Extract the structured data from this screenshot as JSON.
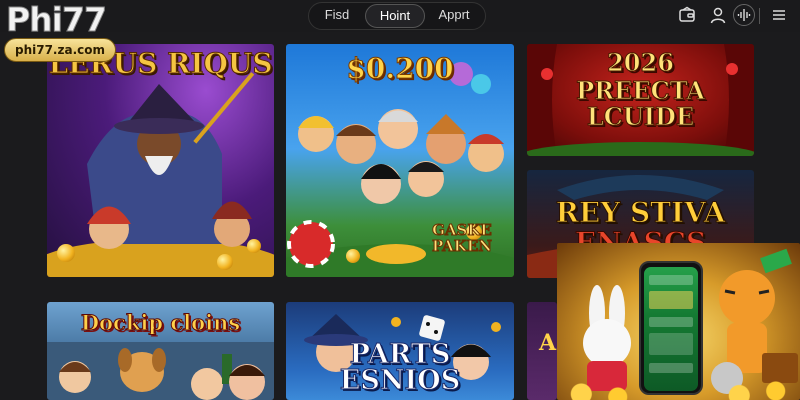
{
  "brand": {
    "logo_text": "Phi77",
    "domain": "phi77.za.com"
  },
  "nav": {
    "tabs": [
      {
        "label": "Fisd",
        "active": false
      },
      {
        "label": "Hoint",
        "active": true
      },
      {
        "label": "Apprt",
        "active": false
      }
    ]
  },
  "toolbar_icons": [
    "wallet-icon",
    "user-icon",
    "sound-icon",
    "menu-icon"
  ],
  "games": [
    {
      "title": "LERUS RIQUS"
    },
    {
      "title": "$0.200",
      "badge": "GASKE PAKEN"
    },
    {
      "title_line1": "2026",
      "title_line2": "PREECTA",
      "title_line3": "LCUIDE"
    },
    {
      "title_line1": "REY STIVA",
      "title_line2": "ENASCS"
    },
    {
      "title": "Dockip cloins"
    },
    {
      "title_line1": "PARTS",
      "title_line2": "ESNIOS"
    },
    {
      "title": "A"
    }
  ],
  "colors": {
    "background": "#1b1b1d",
    "gold": "#f5c542",
    "promo_green": "#1d8a3c"
  }
}
